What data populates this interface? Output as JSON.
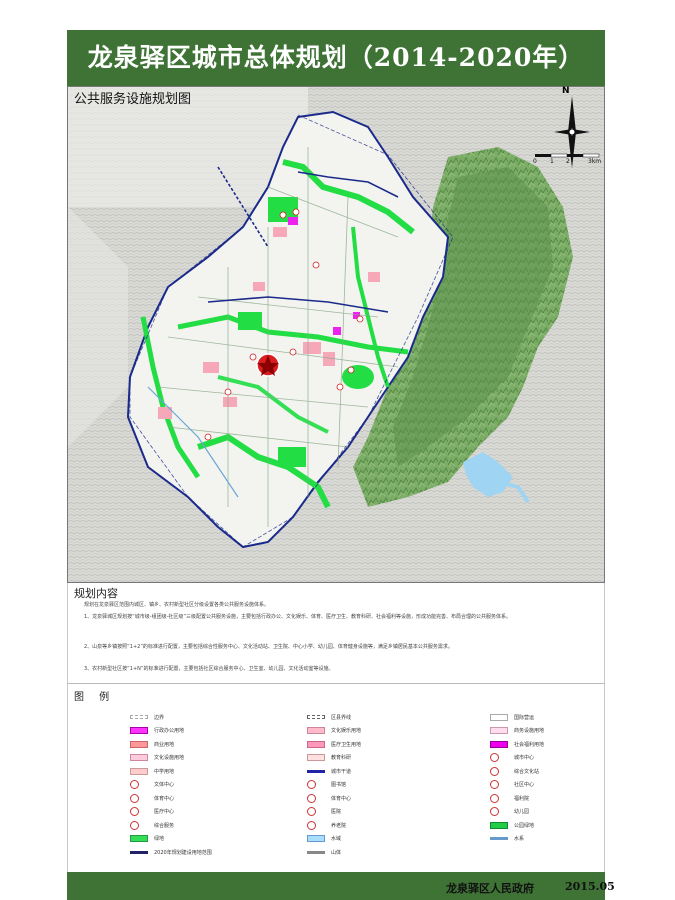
{
  "header": {
    "title": "龙泉驿区城市总体规划（2014-2020年）",
    "map_subtitle": "公共服务设施规划图"
  },
  "compass": {
    "north_label": "N"
  },
  "scale": {
    "labels": [
      "0",
      "1",
      "2",
      "3km"
    ]
  },
  "content": {
    "section_title": "规划内容",
    "paragraphs": [
      "规划在龙泉驿区范围内城区、镇乡、农村新型社区分级设置各类公共服务设施体系。",
      "1、龙泉驿城区规划按“城市级-组团级-社区级”三级配置公共服务设施，主要包括行政办公、文化娱乐、体育、医疗卫生、教育科研、社会福利等设施，形成功能完善、布局合理的公共服务体系。",
      "2、山泉等乡镇按照“1+2”的标准进行配置，主要包括综合性服务中心、文化活动站、卫生院、中心小学、幼儿园、体育健身设施等，满足乡镇居民基本公共服务需求。",
      "3、农村新型社区按“1+N”的标准进行配置，主要包括社区综合服务中心、卫生室、幼儿园、文化活动室等设施。"
    ]
  },
  "legend": {
    "title": "图 例",
    "items": [
      {
        "label": "边界",
        "color": "#ffffff",
        "border": "#aaaaaa",
        "style": "dash"
      },
      {
        "label": "行政办公用地",
        "color": "#ff33ff",
        "border": "#aa00aa",
        "style": "fill"
      },
      {
        "label": "商业用地",
        "color": "#ff9999",
        "border": "#cc6666",
        "style": "fill"
      },
      {
        "label": "文化设施用地",
        "color": "#ffccdd",
        "border": "#cc8899",
        "style": "fill"
      },
      {
        "label": "中学用地",
        "color": "#ffcccc",
        "border": "#cc9999",
        "style": "fill"
      },
      {
        "label": "文体中心",
        "color": "#ffffff",
        "border": "#cc3333",
        "style": "icon"
      },
      {
        "label": "体育中心",
        "color": "#ffffff",
        "border": "#cc3333",
        "style": "icon"
      },
      {
        "label": "医疗中心",
        "color": "#ffffff",
        "border": "#cc3333",
        "style": "icon"
      },
      {
        "label": "综合服务",
        "color": "#ffffff",
        "border": "#cc3333",
        "style": "icon"
      },
      {
        "label": "绿地",
        "color": "#33dd55",
        "border": "#229944",
        "style": "fill"
      },
      {
        "label": "2020年规划建设用地范围",
        "color": "#ffffff",
        "border": "#222266",
        "style": "line"
      },
      {
        "label": "区县界线",
        "color": "#ffffff",
        "border": "#666666",
        "style": "dash"
      },
      {
        "label": "文化娱乐用地",
        "color": "#ffbbcc",
        "border": "#cc8899",
        "style": "fill"
      },
      {
        "label": "医疗卫生用地",
        "color": "#ff99bb",
        "border": "#cc6688",
        "style": "fill"
      },
      {
        "label": "教育科研",
        "color": "#ffe0e0",
        "border": "#cc9999",
        "style": "fill"
      },
      {
        "label": "城市干道",
        "color": "#ffffff",
        "border": "#2222aa",
        "style": "line"
      },
      {
        "label": "图书馆",
        "color": "#ffffff",
        "border": "#cc3333",
        "style": "icon"
      },
      {
        "label": "体育中心",
        "color": "#ffffff",
        "border": "#cc3333",
        "style": "icon"
      },
      {
        "label": "医院",
        "color": "#ffffff",
        "border": "#cc3333",
        "style": "icon"
      },
      {
        "label": "养老院",
        "color": "#ffffff",
        "border": "#cc3333",
        "style": "icon"
      },
      {
        "label": "水域",
        "color": "#aaddff",
        "border": "#6699cc",
        "style": "fill"
      },
      {
        "label": "山体",
        "color": "#ffffff",
        "border": "#888888",
        "style": "line"
      },
      {
        "label": "国际营运",
        "color": "#ffffff",
        "border": "#aaaaaa",
        "style": "fill"
      },
      {
        "label": "商务设施用地",
        "color": "#ffddee",
        "border": "#cc99aa",
        "style": "fill"
      },
      {
        "label": "社会福利用地",
        "color": "#ee00ee",
        "border": "#990099",
        "style": "fill"
      },
      {
        "label": "城市中心",
        "color": "#ffffff",
        "border": "#cc3333",
        "style": "icon"
      },
      {
        "label": "综合文化站",
        "color": "#ffffff",
        "border": "#cc3333",
        "style": "icon"
      },
      {
        "label": "社区中心",
        "color": "#ffffff",
        "border": "#cc3333",
        "style": "icon"
      },
      {
        "label": "福利院",
        "color": "#ffffff",
        "border": "#cc3333",
        "style": "icon"
      },
      {
        "label": "幼儿园",
        "color": "#ffffff",
        "border": "#cc3333",
        "style": "icon"
      },
      {
        "label": "公园绿地",
        "color": "#22cc44",
        "border": "#118833",
        "style": "fill"
      },
      {
        "label": "水系",
        "color": "#ffffff",
        "border": "#6699cc",
        "style": "line"
      }
    ]
  },
  "footer": {
    "issuer": "龙泉驿区人民政府",
    "date": "2015.05"
  },
  "colors": {
    "band": "#3e7335",
    "urban_land": "#f2f2ee",
    "green_space": "#22dd44",
    "boundary": "#1a2a8a",
    "terrain": "#7eaa6a",
    "water": "#9fd4f2",
    "commercial": "#f7a8b8",
    "center_marker": "#d81e1e"
  }
}
